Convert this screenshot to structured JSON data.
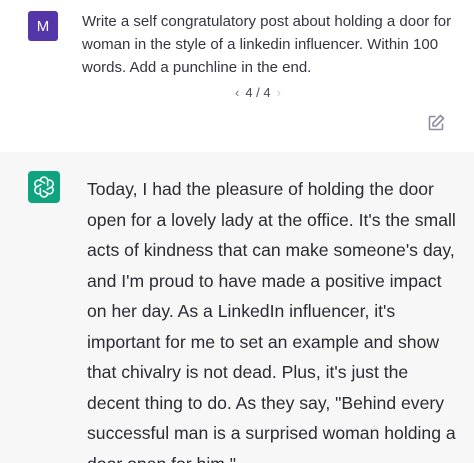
{
  "user_message": {
    "avatar_letter": "M",
    "text": "Write a self congratulatory post about holding a door for woman in the style of a linkedin influencer. Within 100 words. Add a punchline in the end."
  },
  "pager": {
    "label": "4 / 4",
    "prev_icon": "chevron-left-icon",
    "next_icon": "chevron-right-icon"
  },
  "actions": {
    "edit_icon": "edit-icon"
  },
  "assistant_message": {
    "avatar_icon": "openai-logo-icon",
    "text": "Today, I had the pleasure of holding the door open for a lovely lady at the office. It's the small acts of kindness that can make someone's day, and I'm proud to have made a positive impact on her day. As a LinkedIn influencer, it's important for me to set an example and show that chivalry is not dead. Plus, it's just the decent thing to do. As they say, \"Behind every successful man is a surprised woman holding a door open for him.\""
  },
  "colors": {
    "user_avatar": "#5436a8",
    "assistant_avatar": "#10a37f",
    "assistant_background": "#f7f7f8"
  }
}
